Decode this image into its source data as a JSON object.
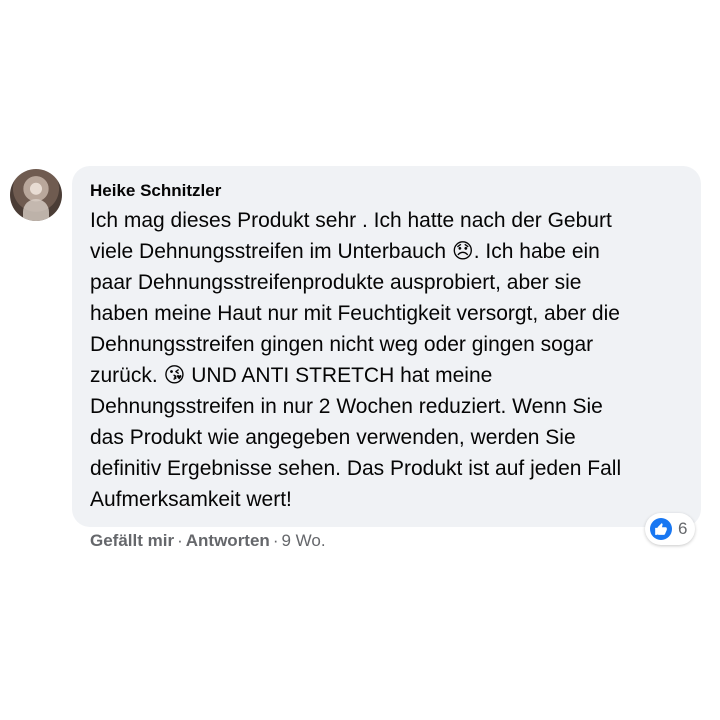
{
  "comment": {
    "author": "Heike Schnitzler",
    "text": "Ich mag dieses Produkt sehr . Ich hatte nach der Geburt\nviele Dehnungsstreifen im Unterbauch 😞. Ich habe ein\npaar Dehnungsstreifenprodukte ausprobiert, aber sie\nhaben meine Haut nur mit Feuchtigkeit versorgt, aber die\nDehnungsstreifen gingen nicht weg oder gingen sogar\nzurück. 😘 UND ANTI STRETCH hat meine\nDehnungsstreifen in nur 2 Wochen reduziert. Wenn Sie\ndas Produkt wie angegeben verwenden, werden Sie\ndefinitiv Ergebnisse sehen. Das Produkt ist auf jeden Fall\nAufmerksamkeit wert!",
    "reaction_icon": "like-icon",
    "reaction_count": "6"
  },
  "actions": {
    "like_label": "Gefällt mir",
    "reply_label": "Antworten",
    "separator": "·",
    "time": "9 Wo."
  },
  "colors": {
    "bubble_bg": "#f0f2f5",
    "text": "#050505",
    "muted": "#65676b",
    "like_blue": "#1877f2"
  }
}
